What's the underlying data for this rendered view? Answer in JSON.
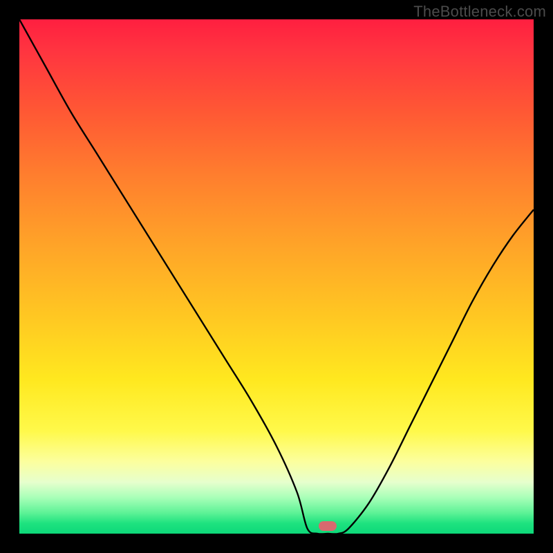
{
  "watermark": "TheBottleneck.com",
  "colors": {
    "frame": "#000000",
    "curve": "#000000",
    "minMarker": "#d86a6f"
  },
  "chart_data": {
    "type": "line",
    "title": "",
    "xlabel": "",
    "ylabel": "",
    "xlim": [
      0,
      100
    ],
    "ylim": [
      0,
      100
    ],
    "plateau_x_range": [
      56,
      62
    ],
    "min_marker_x": 60,
    "series": [
      {
        "name": "bottleneck-curve",
        "x": [
          0,
          5,
          10,
          15,
          20,
          25,
          30,
          35,
          40,
          45,
          50,
          54,
          56,
          58,
          60,
          62,
          64,
          68,
          72,
          76,
          80,
          84,
          88,
          92,
          96,
          100
        ],
        "y": [
          100,
          91,
          82,
          74,
          66,
          58,
          50,
          42,
          34,
          26,
          17,
          8,
          1,
          0,
          0,
          0,
          1,
          6,
          13,
          21,
          29,
          37,
          45,
          52,
          58,
          63
        ]
      }
    ]
  }
}
